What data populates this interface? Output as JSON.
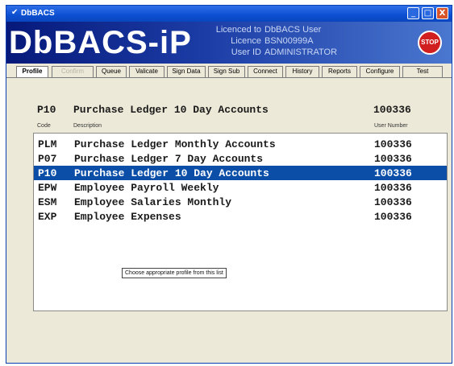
{
  "window": {
    "title": "DbBACS",
    "title_check": "✔"
  },
  "titlebar_buttons": {
    "minimize": "_",
    "maximize": "□",
    "close": "X"
  },
  "banner": {
    "brand": "DbBACS-iP",
    "licence_label": "Licenced to",
    "licence_value": "DbBACS User",
    "licence_no_label": "Licence",
    "licence_no_value": "BSN00999A",
    "user_id_label": "User ID",
    "user_id_value": "ADMINISTRATOR",
    "stop_label": "STOP"
  },
  "tabs": [
    {
      "label": "Profile",
      "state": "active"
    },
    {
      "label": "Confirm",
      "state": "disabled"
    },
    {
      "label": "Queue",
      "state": "normal"
    },
    {
      "label": "Valicate",
      "state": "normal"
    },
    {
      "label": "Sign Data",
      "state": "normal"
    },
    {
      "label": "Sign Sub",
      "state": "normal"
    },
    {
      "label": "Connect",
      "state": "normal"
    },
    {
      "label": "History",
      "state": "normal"
    },
    {
      "label": "Reports",
      "state": "normal"
    },
    {
      "label": "Configure",
      "state": "normal"
    },
    {
      "label": "Test",
      "state": "normal"
    }
  ],
  "selected_profile": {
    "code": "P10",
    "description": "Purchase Ledger 10 Day Accounts",
    "user_number": "100336"
  },
  "columns": {
    "code": "Code",
    "description": "Description",
    "user_number": "User Number"
  },
  "profiles": [
    {
      "code": "PLM",
      "description": "Purchase Ledger Monthly Accounts",
      "user_number": "100336"
    },
    {
      "code": "P07",
      "description": "Purchase Ledger 7 Day Accounts",
      "user_number": "100336"
    },
    {
      "code": "P10",
      "description": "Purchase Ledger 10 Day Accounts",
      "user_number": "100336"
    },
    {
      "code": "EPW",
      "description": "Employee Payroll Weekly",
      "user_number": "100336"
    },
    {
      "code": "ESM",
      "description": "Employee Salaries Monthly",
      "user_number": "100336"
    },
    {
      "code": "EXP",
      "description": "Employee Expenses",
      "user_number": "100336"
    }
  ],
  "selected_index": 2,
  "hint": "Choose appropriate profile from this list",
  "colors": {
    "accent": "#0a4ea8",
    "banner": "#1c3da6",
    "stop": "#d11f1f"
  }
}
